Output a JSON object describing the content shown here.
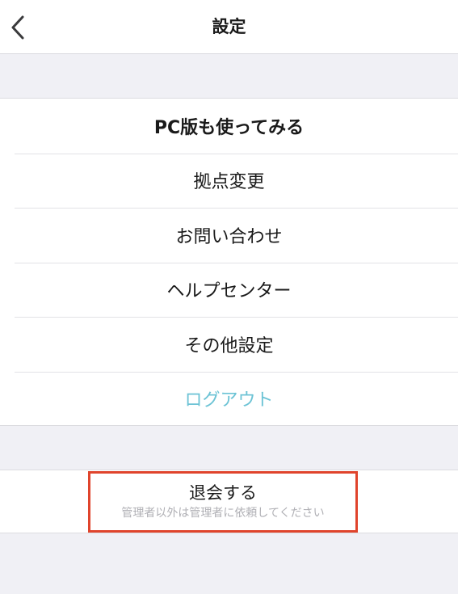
{
  "header": {
    "title": "設定",
    "back_icon": "chevron-left-icon"
  },
  "menu": {
    "items": [
      {
        "label": "PC版も使ってみる"
      },
      {
        "label": "拠点変更"
      },
      {
        "label": "お問い合わせ"
      },
      {
        "label": "ヘルプセンター"
      },
      {
        "label": "その他設定"
      },
      {
        "label": "ログアウト"
      }
    ]
  },
  "withdraw": {
    "label": "退会する",
    "note": "管理者以外は管理者に依頼してください"
  },
  "colors": {
    "background": "#f0f0f5",
    "logout": "#6cc3d5",
    "highlight_border": "#e0442c",
    "note_text": "#b0b0b5"
  }
}
